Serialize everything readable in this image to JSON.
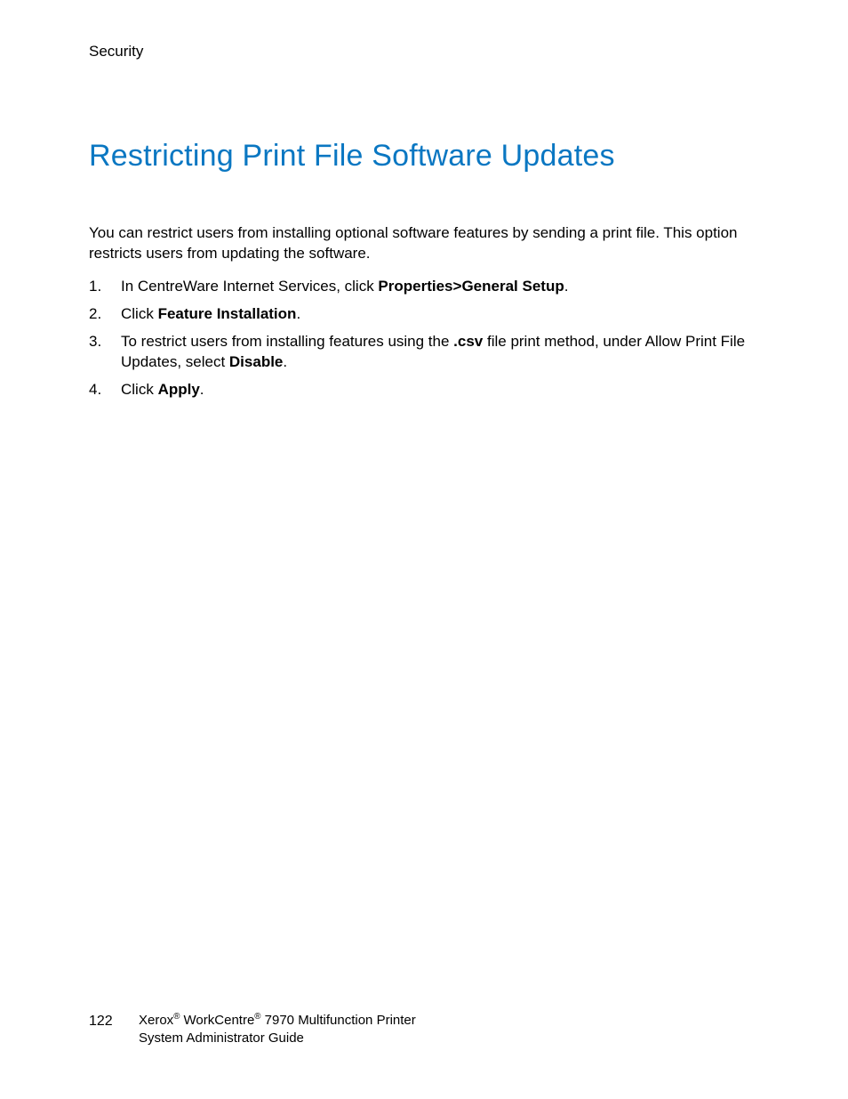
{
  "header": {
    "section": "Security"
  },
  "title": "Restricting Print File Software Updates",
  "intro": "You can restrict users from installing optional software features by sending a print file. This option restricts users from updating the software.",
  "steps": {
    "s1": {
      "pre": "In CentreWare Internet Services, click ",
      "b1": "Properties",
      "sep": ">",
      "b2": "General Setup",
      "post": "."
    },
    "s2": {
      "pre": "Click ",
      "b1": "Feature Installation",
      "post": "."
    },
    "s3": {
      "pre": "To restrict users from installing features using the ",
      "b1": ".csv",
      "mid": " file print method, under Allow Print File Updates, select ",
      "b2": "Disable",
      "post": "."
    },
    "s4": {
      "pre": "Click ",
      "b1": "Apply",
      "post": "."
    }
  },
  "footer": {
    "page_number": "122",
    "brand1": "Xerox",
    "reg": "®",
    "brand2": " WorkCentre",
    "model_suffix": " 7970 Multifunction Printer",
    "line2": "System Administrator Guide"
  }
}
